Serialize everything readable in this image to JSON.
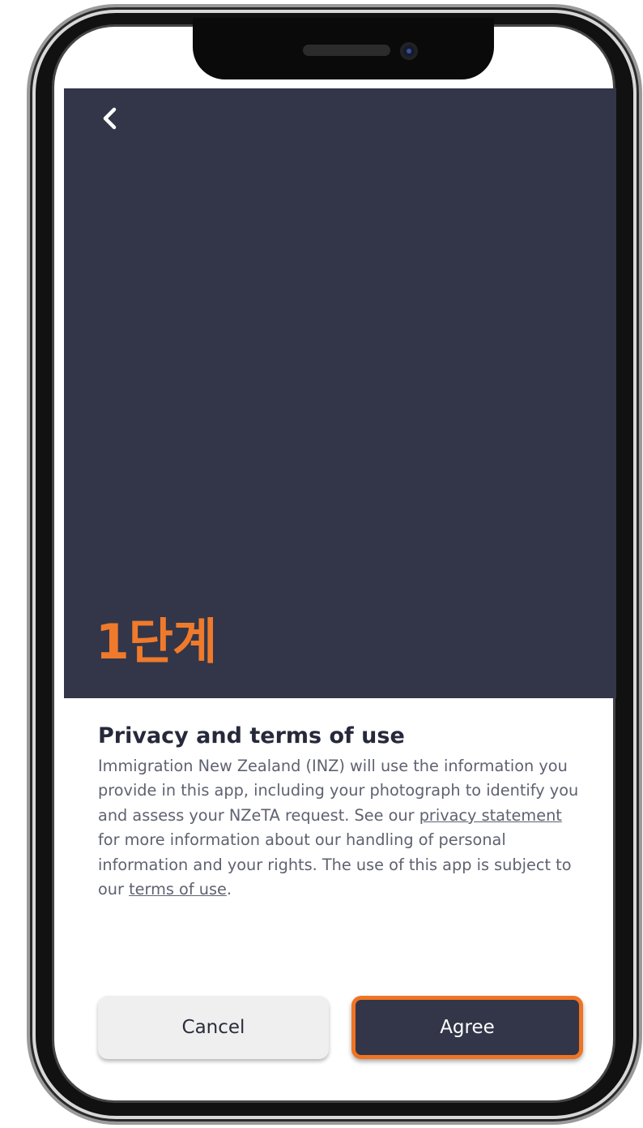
{
  "header": {
    "back_icon": "chevron-left-icon"
  },
  "annotation": {
    "step_label": "1단계",
    "color": "#ef7a2c"
  },
  "content": {
    "title": "Privacy and terms of use",
    "body_part1": "Immigration New Zealand (INZ) will use the information you provide in this app, including your photograph to identify you and assess your NZeTA request. See our ",
    "privacy_link": "privacy statement",
    "body_part2": " for more information about our handling of personal information and your rights. The use of this app is subject to our ",
    "terms_link": "terms of use",
    "body_part3": "."
  },
  "buttons": {
    "cancel_label": "Cancel",
    "agree_label": "Agree"
  },
  "colors": {
    "hero_bg": "#323648",
    "accent_highlight": "#ef7423",
    "agree_bg": "#333648",
    "cancel_bg": "#efefef"
  }
}
